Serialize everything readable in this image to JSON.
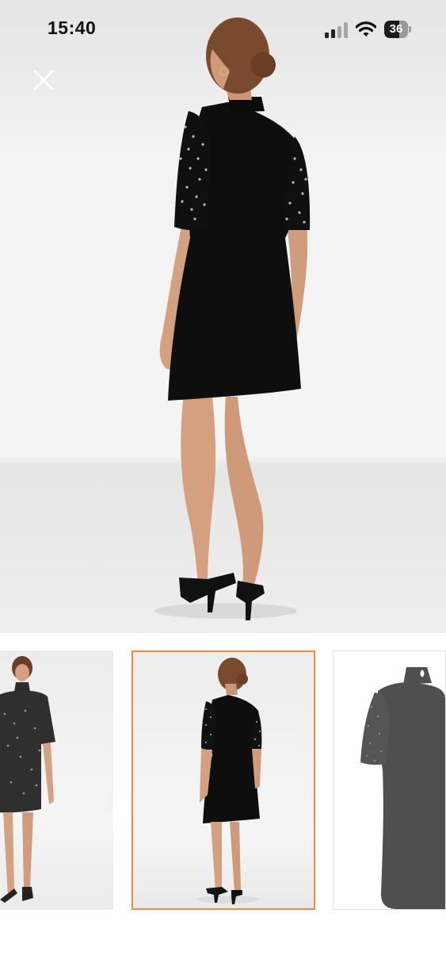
{
  "status_bar": {
    "time": "15:40",
    "battery": "36",
    "battery_level": 0.36
  },
  "viewer": {
    "close_icon": "close-icon",
    "main_image": "black-dress-back-view",
    "thumbnails": [
      {
        "name": "thumbnail-front-view",
        "selected": false
      },
      {
        "name": "thumbnail-back-view",
        "selected": true
      },
      {
        "name": "thumbnail-product-detail",
        "selected": false
      }
    ]
  },
  "colors": {
    "accent": "#ef8a3a",
    "dress": "#0e0e0e",
    "skin": "#d9a988"
  }
}
